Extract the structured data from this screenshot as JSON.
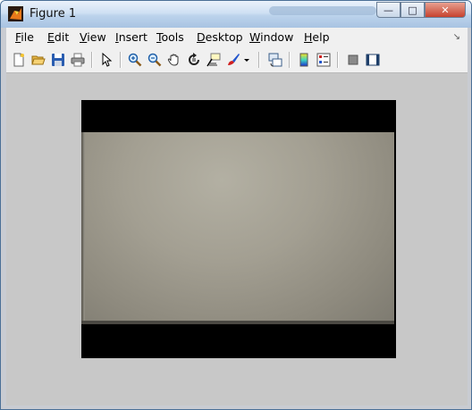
{
  "window": {
    "title": "Figure 1",
    "min_glyph": "—",
    "max_glyph": "□",
    "close_glyph": "✕"
  },
  "menubar": {
    "items": [
      "File",
      "Edit",
      "View",
      "Insert",
      "Tools",
      "Desktop",
      "Window",
      "Help"
    ],
    "dock_arrow": "↘"
  },
  "toolbar": {
    "icons": [
      "new-figure-icon",
      "open-file-icon",
      "save-icon",
      "print-icon",
      "edit-plot-arrow-icon",
      "zoom-in-icon",
      "zoom-out-icon",
      "pan-hand-icon",
      "rotate-3d-icon",
      "data-cursor-icon",
      "brush-icon",
      "brush-dropdown-icon",
      "link-plot-icon",
      "insert-colorbar-icon",
      "insert-legend-icon",
      "hide-plot-tools-icon",
      "show-plot-tools-icon"
    ]
  },
  "colors": {
    "titlebar": "#cfe0f3",
    "canvas": "#c8c8c8",
    "image_background": "#000000",
    "close_button": "#c6422e"
  }
}
